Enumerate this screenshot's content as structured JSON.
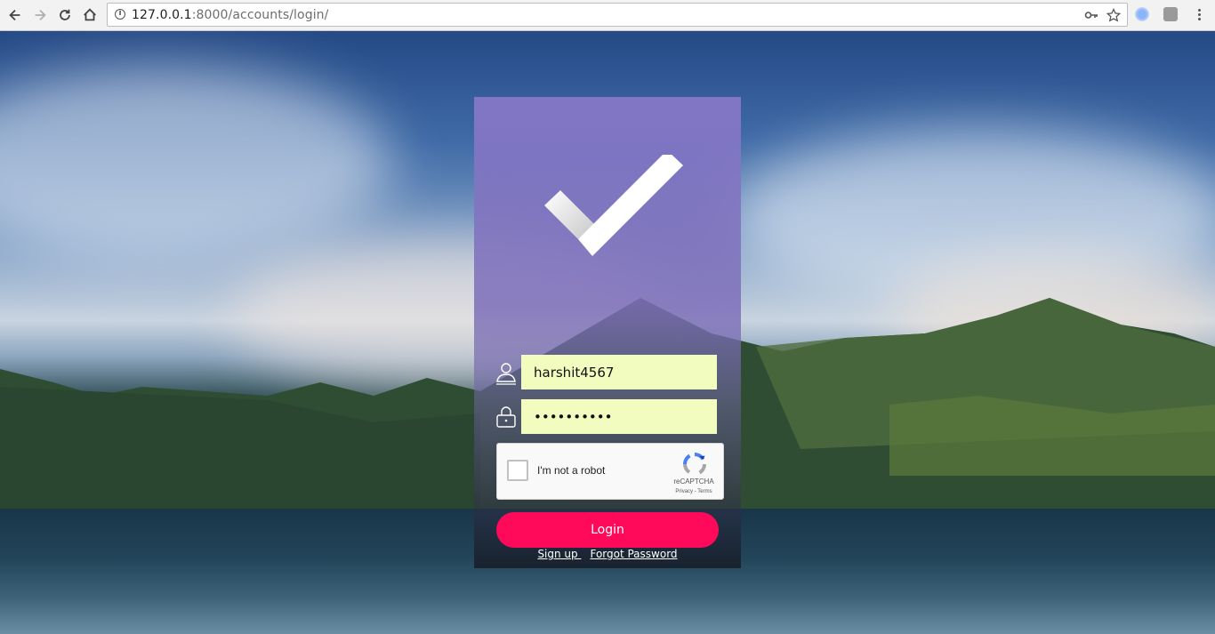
{
  "browser": {
    "url_host": "127.0.0.1",
    "url_rest": ":8000/accounts/login/",
    "icons": [
      "back-arrow-icon",
      "forward-arrow-icon",
      "reload-icon",
      "home-icon",
      "info-icon",
      "key-icon",
      "star-icon",
      "extension-icon",
      "extension-icon-2",
      "menu-icon"
    ]
  },
  "login": {
    "username_value": "harshit4567",
    "password_value": "••••••••••",
    "captcha_label": "I'm not a robot",
    "captcha_brand": "reCAPTCHA",
    "captcha_links": "Privacy - Terms",
    "login_label": "Login",
    "signup_label": "Sign up ",
    "forgot_label": "Forgot Password"
  },
  "colors": {
    "accent": "#ff0a5a",
    "input_bg": "#f3fcbf",
    "card_top": "#8778c8"
  }
}
